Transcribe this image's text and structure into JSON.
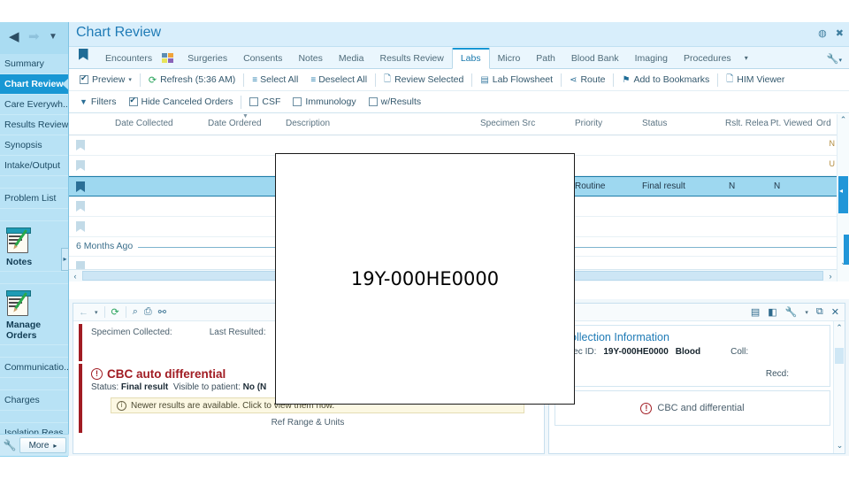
{
  "sidebar": {
    "nav": {
      "back_icon": "back-arrow-icon",
      "forward_icon": "forward-arrow-icon",
      "dropdown_icon": "chevron-down-icon"
    },
    "items": [
      {
        "label": "Summary",
        "active": false
      },
      {
        "label": "Chart Review",
        "active": true
      },
      {
        "label": "Care Everywh...",
        "active": false
      },
      {
        "label": "Results Review",
        "active": false
      },
      {
        "label": "Synopsis",
        "active": false
      },
      {
        "label": "Intake/Output",
        "active": false
      }
    ],
    "items2": [
      {
        "label": "Problem List"
      }
    ],
    "big_items": [
      {
        "label": "Notes"
      },
      {
        "label": "Manage Orders"
      }
    ],
    "items3": [
      {
        "label": "Communicatio..."
      },
      {
        "label": "Charges"
      },
      {
        "label": "Isolation Reas..."
      }
    ],
    "collapse_icon": "chevron-down-icon",
    "footer": {
      "wrench_icon": "wrench-icon",
      "more_label": "More",
      "more_caret": "▸"
    },
    "flyout_icon": "▸"
  },
  "titlebar": {
    "title": "Chart Review",
    "help_icon": "help-icon",
    "close_icon": "close-icon"
  },
  "tabs": {
    "bookmark_icon": "bookmark-icon",
    "grid_icon": "grid-icon",
    "items": [
      {
        "label": "Encounters",
        "active": false
      },
      {
        "label": "Surgeries",
        "active": false
      },
      {
        "label": "Consents",
        "active": false
      },
      {
        "label": "Notes",
        "active": false
      },
      {
        "label": "Media",
        "active": false
      },
      {
        "label": "Results Review",
        "active": false
      },
      {
        "label": "Labs",
        "active": true
      },
      {
        "label": "Micro",
        "active": false
      },
      {
        "label": "Path",
        "active": false
      },
      {
        "label": "Blood Bank",
        "active": false
      },
      {
        "label": "Imaging",
        "active": false
      },
      {
        "label": "Procedures",
        "active": false
      }
    ],
    "overflow_caret": "▾",
    "wrench_icon": "wrench-icon",
    "wrench_caret": "▾"
  },
  "toolbar1": {
    "preview_label": "Preview",
    "preview_caret": "▾",
    "refresh_label": "Refresh (5:36 AM)",
    "select_all_label": "Select All",
    "deselect_all_label": "Deselect All",
    "review_selected_label": "Review Selected",
    "lab_flowsheet_label": "Lab Flowsheet",
    "route_label": "Route",
    "add_to_bookmarks_label": "Add to Bookmarks",
    "him_viewer_label": "HIM Viewer"
  },
  "toolbar2": {
    "filters_label": "Filters",
    "hide_canceled_label": "Hide Canceled Orders",
    "csf_label": "CSF",
    "immunology_label": "Immunology",
    "wresults_label": "w/Results"
  },
  "table": {
    "columns": [
      {
        "label": "Date Collected"
      },
      {
        "label": "Date Ordered"
      },
      {
        "label": "Description"
      },
      {
        "label": "Specimen Src"
      },
      {
        "label": "Priority"
      },
      {
        "label": "Status"
      },
      {
        "label": "Rslt. Relea"
      },
      {
        "label": "Pt. Viewed"
      },
      {
        "label": "Ord"
      }
    ],
    "rows": [
      {
        "selected": false,
        "priority": "",
        "status": "",
        "rslt": "",
        "viewed": ""
      },
      {
        "selected": false,
        "priority": "",
        "status": "",
        "rslt": "",
        "viewed": ""
      },
      {
        "selected": true,
        "priority": "Routine",
        "status": "Final result",
        "rslt": "N",
        "viewed": "N"
      },
      {
        "selected": false,
        "priority": "",
        "status": "",
        "rslt": "",
        "viewed": ""
      },
      {
        "selected": false,
        "priority": "",
        "status": "",
        "rslt": "",
        "viewed": ""
      }
    ],
    "group_label": "6 Months Ago",
    "scroll_left_icon": "‹",
    "scroll_right_icon": "›",
    "scroll_up_icon": "⌃",
    "scroll_down_icon": "⌄",
    "hint_top": "N",
    "hint_bottom": "U"
  },
  "result_pane": {
    "toolbar": {
      "back_icon": "back-arrow-icon",
      "back_caret": "▾",
      "refresh_icon": "refresh-icon",
      "search_icon": "search-icon",
      "print_icon": "printer-icon",
      "link_icon": "link-icon"
    },
    "specimen_collected_label": "Specimen Collected:",
    "last_resulted_label": "Last Resulted:",
    "cbc_title": "CBC auto differential",
    "cbc_warning_icon": "warning-icon",
    "status_prefix": "Status:",
    "status_value": "Final result",
    "visible_prefix": "Visible to patient:",
    "visible_value": "No (N",
    "notice_icon": "info-icon",
    "notice_text": "Newer results are available. Click to view them now.",
    "ref_range_label": "Ref Range & Units"
  },
  "detail_pane": {
    "toolbar_icons": [
      {
        "name": "notes-icon",
        "glyph": "▤"
      },
      {
        "name": "sidebar-panel-icon",
        "glyph": "◧"
      },
      {
        "name": "wrench-icon",
        "glyph": "🔧"
      },
      {
        "name": "chevron-down-icon",
        "glyph": "▾"
      },
      {
        "name": "copy-icon",
        "glyph": "⧉"
      },
      {
        "name": "close-icon",
        "glyph": "✕"
      }
    ],
    "collection_title": "Collection Information",
    "spec_id_label": "Spec ID:",
    "spec_id_value": "19Y-000HE0000",
    "specimen_type": "Blood",
    "coll_label": "Coll:",
    "recd_label": "Recd:",
    "test_name": "CBC and differential",
    "test_warning_icon": "warning-icon",
    "scroll_up_icon": "⌃",
    "scroll_down_icon": "⌄"
  },
  "overlay": {
    "text": "19Y-000HE0000"
  },
  "colors": {
    "accent_blue": "#1897d4",
    "sidebar_blue": "#b8e2f5",
    "title_blue": "#1f7bb6",
    "alert_red": "#a11c23",
    "selection_blue": "#9ed8f0"
  }
}
